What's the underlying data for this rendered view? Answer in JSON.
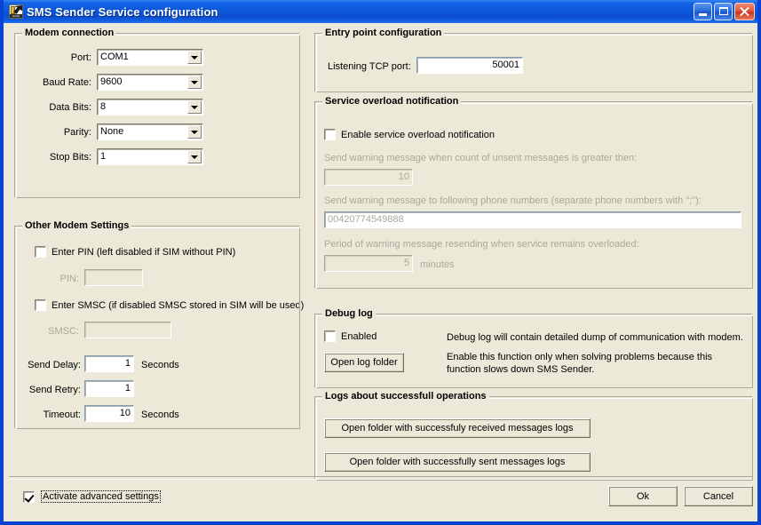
{
  "window": {
    "title": "SMS Sender Service configuration",
    "icon": "app-icon",
    "icon_label": "DLDD",
    "minimize_label": "",
    "maximize_label": "",
    "close_label": "",
    "titlebar_color": "#0A42D4",
    "client_bg": "#ECE9D8"
  },
  "modem_connection": {
    "title": "Modem connection",
    "rows": [
      {
        "label": "Port:",
        "value": "COM1"
      },
      {
        "label": "Baud Rate:",
        "value": "9600"
      },
      {
        "label": "Data Bits:",
        "value": "8"
      },
      {
        "label": "Parity:",
        "value": "None"
      },
      {
        "label": "Stop Bits:",
        "value": "1"
      }
    ]
  },
  "other_modem_settings": {
    "title": "Other Modem Settings",
    "enter_pin_label": "Enter PIN (left disabled if SIM without PIN)",
    "enter_pin_checked": false,
    "pin_label": "PIN:",
    "pin_value": "",
    "enter_smsc_label": "Enter SMSC (if disabled SMSC stored in SIM will be used)",
    "enter_smsc_checked": false,
    "smsc_label": "SMSC:",
    "smsc_value": "",
    "send_delay_label": "Send Delay:",
    "send_delay_value": "1",
    "send_delay_unit": "Seconds",
    "send_retry_label": "Send Retry:",
    "send_retry_value": "1",
    "timeout_label": "Timeout:",
    "timeout_value": "10",
    "timeout_unit": "Seconds"
  },
  "entry_point": {
    "title": "Entry point configuration",
    "port_label": "Listening TCP port:",
    "port_value": "50001"
  },
  "service_overload": {
    "title": "Service overload notification",
    "enable_label": "Enable service overload notification",
    "enable_checked": false,
    "count_label": "Send warning message when count of unsent messages is greater then:",
    "count_value": "10",
    "phones_label": "Send warning message to following phone numbers (separate phone numbers with \";\"):",
    "phones_value": "00420774549888",
    "period_label": "Period of warning message resending when service remains overloaded:",
    "period_value": "5",
    "period_unit": "minutes"
  },
  "debug_log": {
    "title": "Debug log",
    "enabled_label": "Enabled",
    "enabled_checked": false,
    "open_folder_button": "Open log folder",
    "description_line1": "Debug log will contain detailed dump of communication with modem.",
    "description_line2": "Enable this function only when solving problems because this",
    "description_line3": "function slows down SMS Sender."
  },
  "success_logs": {
    "title": "Logs about successfull operations",
    "received_button": "Open folder with successfuly received messages logs",
    "sent_button": "Open folder with successfully sent messages logs"
  },
  "footer": {
    "advanced_label": "Activate advanced settings",
    "advanced_checked": true,
    "ok_label": "Ok",
    "cancel_label": "Cancel"
  }
}
